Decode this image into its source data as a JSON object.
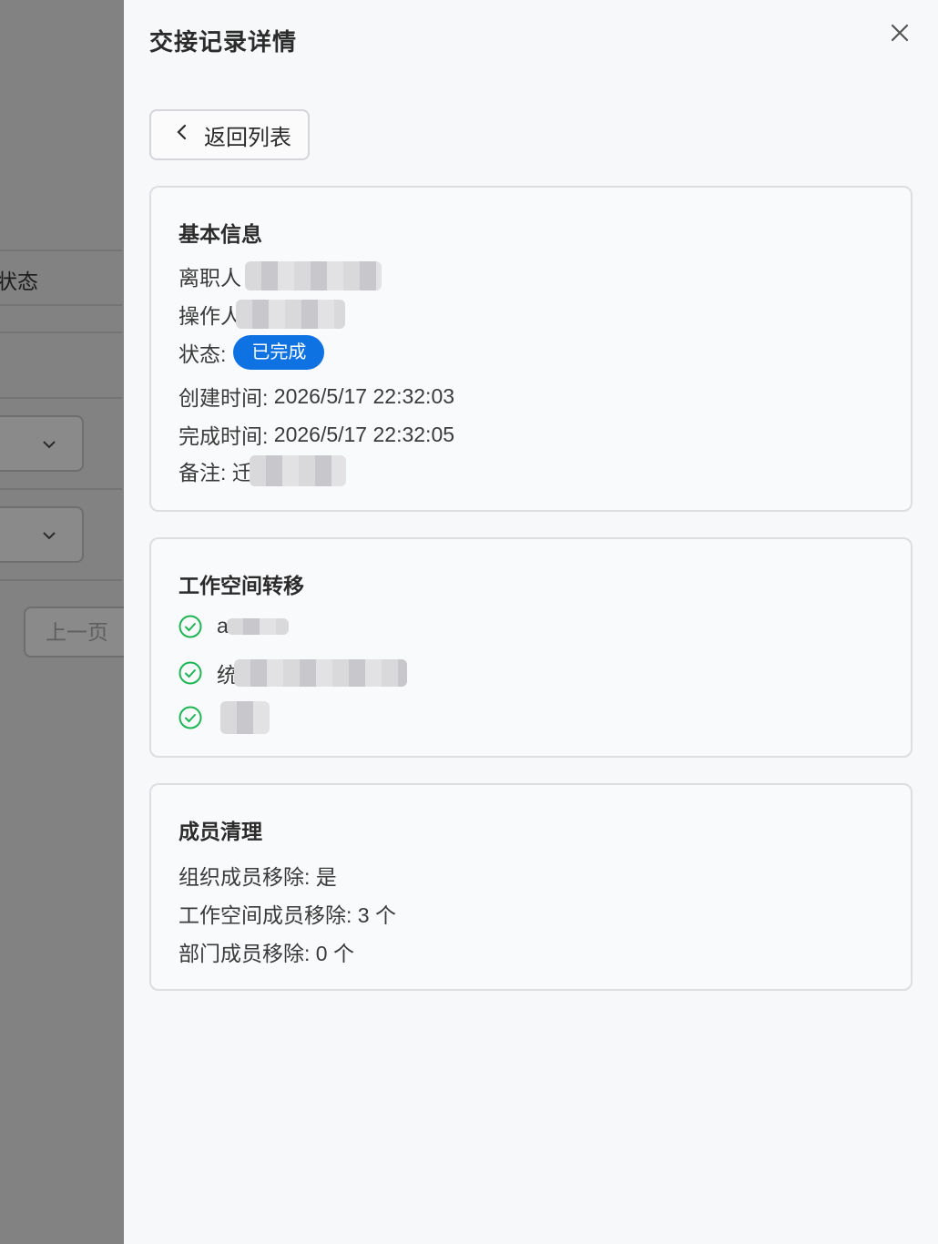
{
  "backdrop": {
    "status_label": "状态",
    "prev_label": "上一页"
  },
  "drawer": {
    "title": "交接记录详情",
    "back_label": "返回列表"
  },
  "basic": {
    "title": "基本信息",
    "leaver_label": "离职人",
    "operator_label": "操作人",
    "status_label": "状态:",
    "status_value": "已完成",
    "created_label": "创建时间:",
    "created_value": "2026/5/17 22:32:03",
    "completed_label": "完成时间:",
    "completed_value": "2026/5/17 22:32:05",
    "note_label": "备注:",
    "note_prefix": "迁"
  },
  "workspace": {
    "title": "工作空间转移",
    "items": [
      {
        "prefix": "a"
      },
      {
        "prefix": "统"
      },
      {
        "prefix": ""
      }
    ]
  },
  "members": {
    "title": "成员清理",
    "org_label": "组织成员移除:",
    "org_value": "是",
    "ws_label": "工作空间成员移除:",
    "ws_value": "3 个",
    "dept_label": "部门成员移除:",
    "dept_value": "0 个"
  },
  "colors": {
    "accent": "#0e72e3",
    "success": "#1fb555",
    "backdrop": "#828282"
  },
  "icons": {
    "close": "close-icon",
    "back": "chevron-left-icon",
    "check": "check-circle-icon",
    "select": "chevron-down-icon"
  }
}
